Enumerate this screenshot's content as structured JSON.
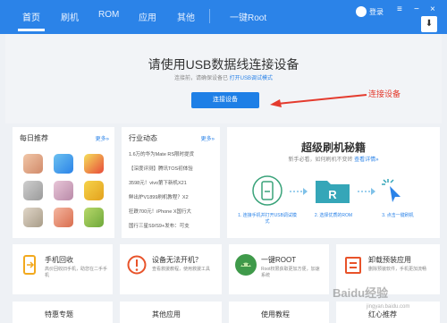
{
  "nav": {
    "tabs": [
      {
        "label": "首页"
      },
      {
        "label": "刷机"
      },
      {
        "label": "ROM"
      },
      {
        "label": "应用"
      },
      {
        "label": "其他"
      }
    ],
    "root_label": "一键Root",
    "login_label": "登录",
    "window_controls": [
      "≡",
      "−",
      "×"
    ],
    "download_icon": "download-icon"
  },
  "connect": {
    "title": "请使用USB数据线连接设备",
    "sub_text": "连接前，请确保设备已",
    "sub_link": "打开USB调试模式",
    "button_label": "连接设备",
    "annotation": "连接设备",
    "annotation_color": "#e43b2e"
  },
  "daily": {
    "title": "每日推荐",
    "more": "更多»"
  },
  "news": {
    "title": "行业动态",
    "more": "更多»",
    "items": [
      "1.6万的华为Mate RS限时提货",
      "【深度评测】腾讯TOS初体验",
      "3598元！vivo第下新机X21",
      "鲜出炉V1899刷机教程？X2",
      "狂跌700元！iPhone X国行大",
      "国行三星S9/S9+发布：可支"
    ]
  },
  "guide": {
    "title": "超级刷机秘籍",
    "sub_text": "新手必看，如何刷机不变砖",
    "sub_link": "查看详情»",
    "steps": [
      "1. 连接手机并打开USB调试模式",
      "2. 选择优质的ROM",
      "3. 点击一键刷机"
    ]
  },
  "features": [
    {
      "icon": "phone-recycle-icon",
      "title": "手机回收",
      "desc": "高价回收旧手机，助您在二手手机"
    },
    {
      "icon": "warning-icon",
      "title": "设备无法开机？",
      "desc": "查看救援教程，使用救援工具"
    },
    {
      "icon": "root-icon",
      "title": "一键ROOT",
      "desc": "Root权限获取更加方便，加速系统"
    },
    {
      "icon": "uninstall-icon",
      "title": "卸载预装应用",
      "desc": "删除预装软件，手机更加流畅"
    }
  ],
  "bottom_row": [
    "特惠专题",
    "其他应用",
    "使用教程",
    "红心推荐"
  ],
  "watermark": {
    "main": "Baidu经验",
    "sub": "jingyan.baidu.com"
  },
  "colors": {
    "accent": "#2b83e8",
    "annotation": "#e43b2e"
  }
}
